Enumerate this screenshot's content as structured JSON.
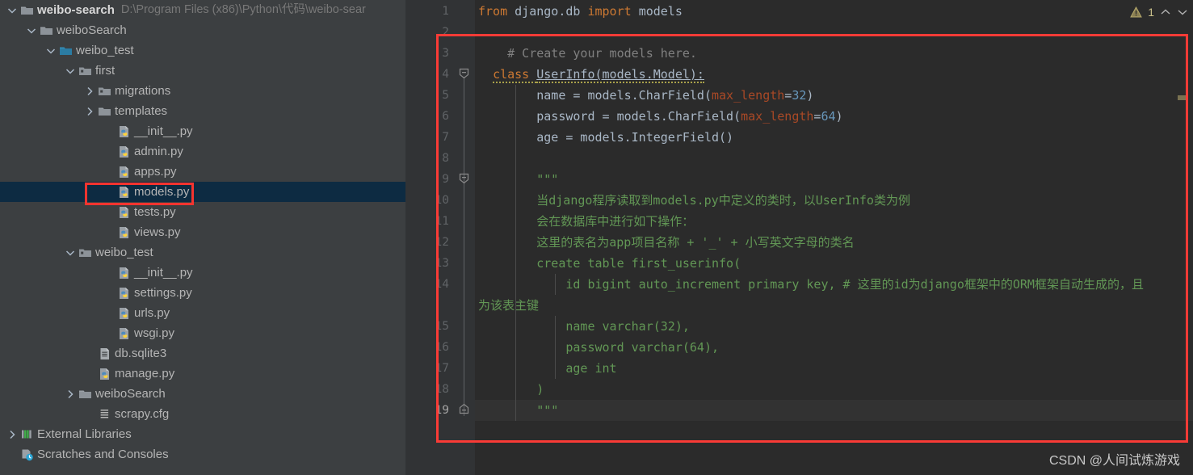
{
  "sidebar": {
    "project_root": {
      "name": "weibo-search",
      "path": "D:\\Program Files (x86)\\Python\\代码\\weibo-sear"
    },
    "items": [
      {
        "label": "weibo-search",
        "path": "D:\\Program Files (x86)\\Python\\代码\\weibo-sear",
        "indent": 0,
        "arrow": "down",
        "icon": "folder-icon",
        "bold": true,
        "selected": false
      },
      {
        "label": "weiboSearch",
        "path": "",
        "indent": 1,
        "arrow": "down",
        "icon": "folder-icon",
        "bold": false,
        "selected": false
      },
      {
        "label": "weibo_test",
        "path": "",
        "indent": 2,
        "arrow": "down",
        "icon": "folder-module-icon",
        "bold": false,
        "selected": false
      },
      {
        "label": "first",
        "path": "",
        "indent": 3,
        "arrow": "down",
        "icon": "folder-package-icon",
        "bold": false,
        "selected": false
      },
      {
        "label": "migrations",
        "path": "",
        "indent": 4,
        "arrow": "right",
        "icon": "folder-package-icon",
        "bold": false,
        "selected": false
      },
      {
        "label": "templates",
        "path": "",
        "indent": 4,
        "arrow": "right",
        "icon": "folder-icon",
        "bold": false,
        "selected": false
      },
      {
        "label": "__init__.py",
        "path": "",
        "indent": 5,
        "arrow": "none",
        "icon": "python-file-icon",
        "bold": false,
        "selected": false
      },
      {
        "label": "admin.py",
        "path": "",
        "indent": 5,
        "arrow": "none",
        "icon": "python-file-icon",
        "bold": false,
        "selected": false
      },
      {
        "label": "apps.py",
        "path": "",
        "indent": 5,
        "arrow": "none",
        "icon": "python-file-icon",
        "bold": false,
        "selected": false
      },
      {
        "label": "models.py",
        "path": "",
        "indent": 5,
        "arrow": "none",
        "icon": "python-file-icon",
        "bold": false,
        "selected": true
      },
      {
        "label": "tests.py",
        "path": "",
        "indent": 5,
        "arrow": "none",
        "icon": "python-file-icon",
        "bold": false,
        "selected": false
      },
      {
        "label": "views.py",
        "path": "",
        "indent": 5,
        "arrow": "none",
        "icon": "python-file-icon",
        "bold": false,
        "selected": false
      },
      {
        "label": "weibo_test",
        "path": "",
        "indent": 3,
        "arrow": "down",
        "icon": "folder-package-icon",
        "bold": false,
        "selected": false
      },
      {
        "label": "__init__.py",
        "path": "",
        "indent": 5,
        "arrow": "none",
        "icon": "python-file-icon",
        "bold": false,
        "selected": false
      },
      {
        "label": "settings.py",
        "path": "",
        "indent": 5,
        "arrow": "none",
        "icon": "python-file-icon",
        "bold": false,
        "selected": false
      },
      {
        "label": "urls.py",
        "path": "",
        "indent": 5,
        "arrow": "none",
        "icon": "python-file-icon",
        "bold": false,
        "selected": false
      },
      {
        "label": "wsgi.py",
        "path": "",
        "indent": 5,
        "arrow": "none",
        "icon": "python-file-icon",
        "bold": false,
        "selected": false
      },
      {
        "label": "db.sqlite3",
        "path": "",
        "indent": 4,
        "arrow": "none",
        "icon": "database-file-icon",
        "bold": false,
        "selected": false
      },
      {
        "label": "manage.py",
        "path": "",
        "indent": 4,
        "arrow": "none",
        "icon": "python-file-icon",
        "bold": false,
        "selected": false
      },
      {
        "label": "weiboSearch",
        "path": "",
        "indent": 3,
        "arrow": "right",
        "icon": "folder-icon",
        "bold": false,
        "selected": false
      },
      {
        "label": "scrapy.cfg",
        "path": "",
        "indent": 4,
        "arrow": "none",
        "icon": "config-file-icon",
        "bold": false,
        "selected": false
      },
      {
        "label": "External Libraries",
        "path": "",
        "indent": 0,
        "arrow": "right",
        "icon": "libraries-icon",
        "bold": false,
        "selected": false
      },
      {
        "label": "Scratches and Consoles",
        "path": "",
        "indent": 0,
        "arrow": "none",
        "icon": "scratches-icon",
        "bold": false,
        "selected": false
      }
    ]
  },
  "editor": {
    "filename": "models.py",
    "current_line": 19,
    "inspection": {
      "warning_count": "1",
      "icon": "warning-triangle-icon",
      "prev_icon": "chevron-up-icon",
      "next_icon": "chevron-down-icon"
    },
    "lines": [
      {
        "n": "1",
        "segments": [
          {
            "t": "from ",
            "c": "kw"
          },
          {
            "t": "django.db ",
            "c": "id"
          },
          {
            "t": "import ",
            "c": "kw"
          },
          {
            "t": "models",
            "c": "id"
          }
        ]
      },
      {
        "n": "2",
        "segments": []
      },
      {
        "n": "3",
        "segments": [
          {
            "t": "    # Create your models here.",
            "c": "cmt"
          }
        ]
      },
      {
        "n": "4",
        "segments": [
          {
            "t": "  ",
            "c": "id"
          },
          {
            "t": "class ",
            "c": "kw squig"
          },
          {
            "t": "UserInfo(models.Model):",
            "c": "cls squig"
          }
        ]
      },
      {
        "n": "5",
        "segments": [
          {
            "t": "        name = models.CharField(",
            "c": "id"
          },
          {
            "t": "max_length",
            "c": "kwarg"
          },
          {
            "t": "=",
            "c": "id"
          },
          {
            "t": "32",
            "c": "num"
          },
          {
            "t": ")",
            "c": "id"
          }
        ]
      },
      {
        "n": "6",
        "segments": [
          {
            "t": "        password = models.CharField(",
            "c": "id"
          },
          {
            "t": "max_length",
            "c": "kwarg"
          },
          {
            "t": "=",
            "c": "id"
          },
          {
            "t": "64",
            "c": "num"
          },
          {
            "t": ")",
            "c": "id"
          }
        ]
      },
      {
        "n": "7",
        "segments": [
          {
            "t": "        age = models.IntegerField()",
            "c": "id"
          }
        ]
      },
      {
        "n": "8",
        "segments": []
      },
      {
        "n": "9",
        "segments": [
          {
            "t": "        \"\"\"",
            "c": "str"
          }
        ]
      },
      {
        "n": "10",
        "segments": [
          {
            "t": "        当django程序读取到models.py中定义的类时，以UserInfo类为例",
            "c": "str"
          }
        ]
      },
      {
        "n": "11",
        "segments": [
          {
            "t": "        会在数据库中进行如下操作：",
            "c": "str"
          }
        ]
      },
      {
        "n": "12",
        "segments": [
          {
            "t": "        这里的表名为app项目名称 + '_' + 小写英文字母的类名",
            "c": "str"
          }
        ]
      },
      {
        "n": "13",
        "segments": [
          {
            "t": "        create table first_userinfo(",
            "c": "str"
          }
        ]
      },
      {
        "n": "14",
        "segments": [
          {
            "t": "            id bigint auto_increment primary key, # 这里的id为django框架中的ORM框架自动生成的，且",
            "c": "str"
          }
        ],
        "wrap": "为该表主键"
      },
      {
        "n": "15",
        "segments": [
          {
            "t": "            name varchar(32),",
            "c": "str"
          }
        ]
      },
      {
        "n": "16",
        "segments": [
          {
            "t": "            password varchar(64),",
            "c": "str"
          }
        ]
      },
      {
        "n": "17",
        "segments": [
          {
            "t": "            age int",
            "c": "str"
          }
        ]
      },
      {
        "n": "18",
        "segments": [
          {
            "t": "        )",
            "c": "str"
          }
        ]
      },
      {
        "n": "19",
        "segments": [
          {
            "t": "        \"\"\"",
            "c": "str"
          }
        ]
      }
    ]
  },
  "watermark": {
    "text": "CSDN @人间试炼游戏"
  },
  "colors": {
    "sidebar_bg": "#3c3f41",
    "editor_bg": "#2b2b2b",
    "gutter_bg": "#313335",
    "selection_bg": "#0d2b42",
    "annotation_red": "#fa3b36",
    "keyword": "#cc7832",
    "string": "#629755",
    "comment": "#808080",
    "number": "#6897bb",
    "kwarg": "#aa4926"
  }
}
